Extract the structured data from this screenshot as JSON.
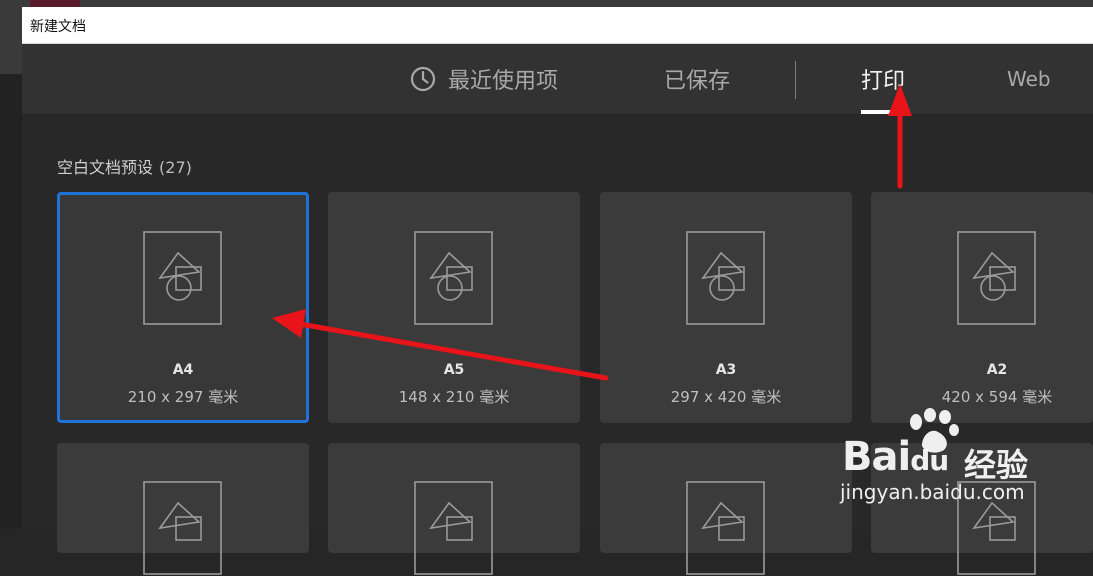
{
  "window": {
    "title": "新建文档"
  },
  "tabs": [
    {
      "label": "最近使用项",
      "icon": "clock-icon",
      "active": false
    },
    {
      "label": "已保存",
      "active": false
    },
    {
      "label": "打印",
      "active": true
    },
    {
      "label": "Web",
      "active": false
    }
  ],
  "section": {
    "title": "空白文档预设",
    "count": "(27)"
  },
  "presets": [
    {
      "name": "A4",
      "dims": "210 x 297 毫米",
      "selected": true
    },
    {
      "name": "A5",
      "dims": "148 x 210 毫米",
      "selected": false
    },
    {
      "name": "A3",
      "dims": "297 x 420 毫米",
      "selected": false
    },
    {
      "name": "A2",
      "dims": "420 x 594 毫米",
      "selected": false
    }
  ],
  "watermark": {
    "brand": "Bai",
    "brand_suffix": "du",
    "product": "经验",
    "url": "jingyan.baidu.com"
  },
  "colors": {
    "accent": "#1f73d8",
    "annotation": "#e8141a",
    "tab_bar": "#323232",
    "card": "#3b3b3b"
  }
}
